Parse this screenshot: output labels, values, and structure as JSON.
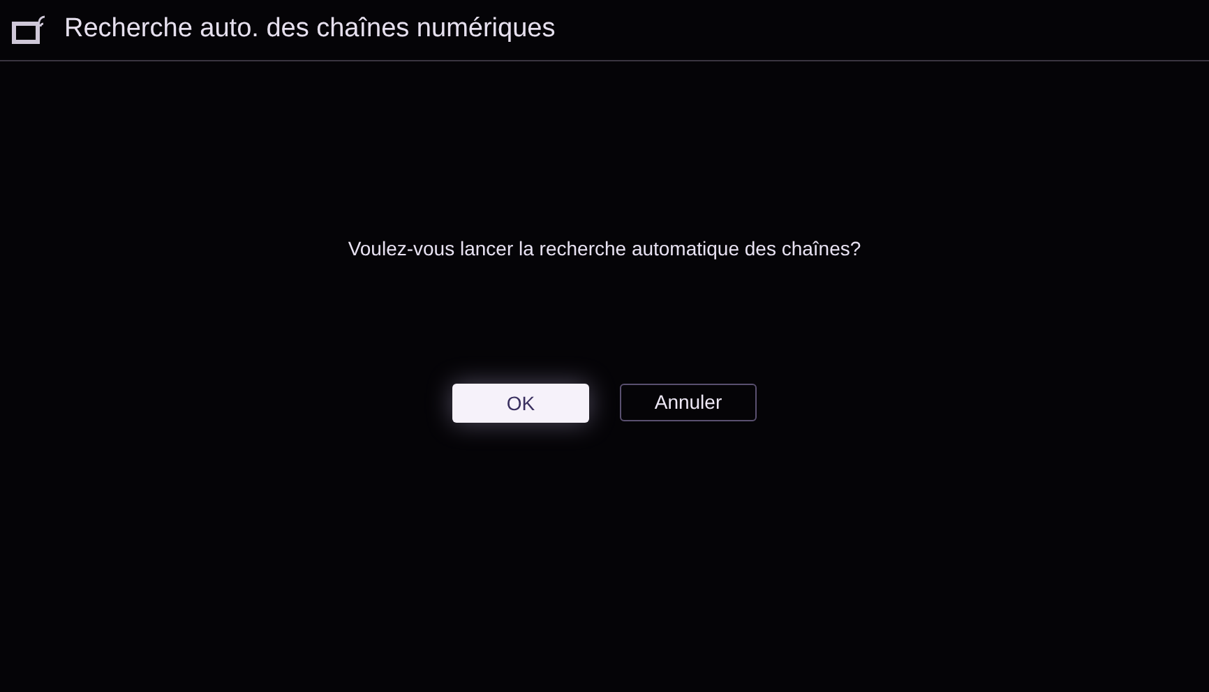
{
  "header": {
    "title": "Recherche auto. des chaînes numériques"
  },
  "dialog": {
    "message": "Voulez-vous lancer la recherche automatique des chaînes?",
    "buttons": [
      {
        "label": "OK",
        "selected": true
      },
      {
        "label": "Annuler",
        "selected": false
      }
    ]
  }
}
